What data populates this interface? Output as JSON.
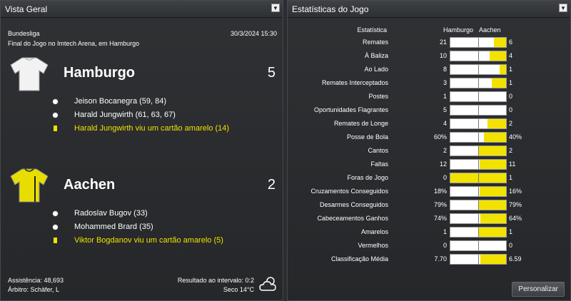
{
  "overview": {
    "title": "Vista Geral",
    "competition": "Bundesliga",
    "datetime": "30/3/2024 15:30",
    "venue": "Final do Jogo no Imtech Arena, em Hamburgo",
    "home": {
      "name": "Hamburgo",
      "score": "5",
      "events": [
        {
          "type": "goal",
          "text": "Jeison Bocanegra (59, 84)"
        },
        {
          "type": "goal",
          "text": "Harald Jungwirth (61, 63, 67)"
        },
        {
          "type": "card",
          "text": "Harald Jungwirth viu um cartão amarelo (14)"
        }
      ]
    },
    "away": {
      "name": "Aachen",
      "score": "2",
      "events": [
        {
          "type": "goal",
          "text": "Radoslav Bugov (33)"
        },
        {
          "type": "goal",
          "text": "Mohammed Brard (35)"
        },
        {
          "type": "card",
          "text": "Viktor Bogdanov viu um cartão amarelo (5)"
        }
      ]
    },
    "attendance": "Assistência: 48,693",
    "referee": "Árbitro: Schäfer, L",
    "halftime": "Resultado ao intervalo: 0:2",
    "weather": "Seco 14°C"
  },
  "stats": {
    "title": "Estatísticas do Jogo",
    "header_label": "Estatística",
    "header_home": "Hamburgo",
    "header_away": "Aachen",
    "button": "Personalizar",
    "rows": [
      {
        "label": "Remates",
        "home": "21",
        "away": "6",
        "away_share": 0.22
      },
      {
        "label": "À Baliza",
        "home": "10",
        "away": "4",
        "away_share": 0.29
      },
      {
        "label": "Ao Lado",
        "home": "8",
        "away": "1",
        "away_share": 0.11
      },
      {
        "label": "Remates Interceptados",
        "home": "3",
        "away": "1",
        "away_share": 0.25
      },
      {
        "label": "Postes",
        "home": "1",
        "away": "0",
        "away_share": 0
      },
      {
        "label": "Oportunidades Flagrantes",
        "home": "5",
        "away": "0",
        "away_share": 0
      },
      {
        "label": "Remates de Longe",
        "home": "4",
        "away": "2",
        "away_share": 0.33
      },
      {
        "label": "Posse de Bola",
        "home": "60%",
        "away": "40%",
        "away_share": 0.4
      },
      {
        "label": "Cantos",
        "home": "2",
        "away": "2",
        "away_share": 0.5
      },
      {
        "label": "Faltas",
        "home": "12",
        "away": "11",
        "away_share": 0.48
      },
      {
        "label": "Foras de Jogo",
        "home": "0",
        "away": "1",
        "away_share": 1
      },
      {
        "label": "Cruzamentos Conseguidos",
        "home": "18%",
        "away": "16%",
        "away_share": 0.47
      },
      {
        "label": "Desarmes Conseguidos",
        "home": "79%",
        "away": "79%",
        "away_share": 0.5
      },
      {
        "label": "Cabeceamentos Ganhos",
        "home": "74%",
        "away": "64%",
        "away_share": 0.46
      },
      {
        "label": "Amarelos",
        "home": "1",
        "away": "1",
        "away_share": 0.5
      },
      {
        "label": "Vermelhos",
        "home": "0",
        "away": "0",
        "away_share": 0
      },
      {
        "label": "Classificação Média",
        "home": "7.70",
        "away": "6.59",
        "away_share": 0.46
      }
    ]
  }
}
